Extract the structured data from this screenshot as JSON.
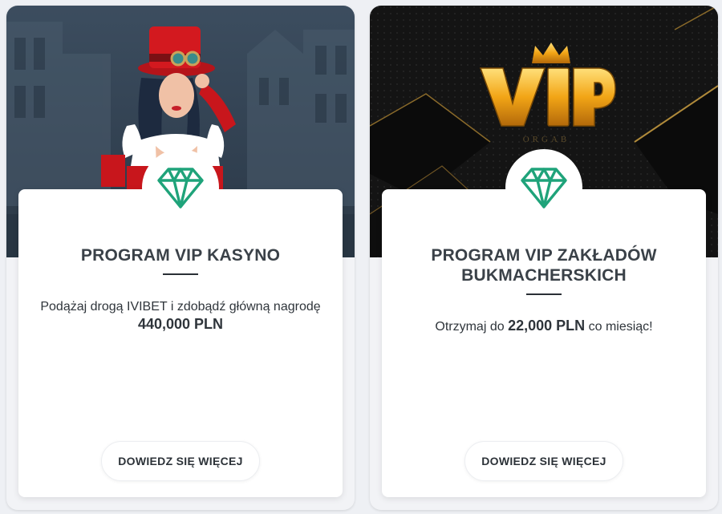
{
  "cards": [
    {
      "title": "PROGRAM VIP KASYNO",
      "description": "Podążaj drogą IVIBET i zdobądź główną nagrodę",
      "amount": "440,000 PLN",
      "button_label": "DOWIEDZ SIĘ WIĘCEJ",
      "icon": "diamond-icon"
    },
    {
      "title_line1": "PROGRAM VIP ZAKŁADÓW",
      "title_line2": "BUKMACHERSKICH",
      "description_prefix": "Otrzymaj do",
      "amount": "22,000 PLN",
      "description_suffix": "co miesiąc!",
      "button_label": "DOWIEDZ SIĘ WIĘCEJ",
      "icon": "diamond-icon",
      "hero_logo": "VIP"
    }
  ],
  "colors": {
    "accent_green": "#1fa37a",
    "heading": "#3a4148",
    "vip_gold": "#e8a417"
  }
}
